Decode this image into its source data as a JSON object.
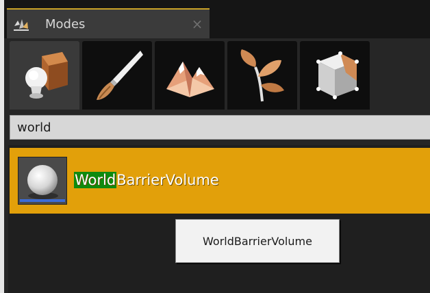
{
  "window": {
    "tab_title": "Modes",
    "tab_icon": "modes-icon",
    "close_glyph": "×"
  },
  "mode_buttons": [
    {
      "name": "place-mode",
      "icon": "place-actors-icon",
      "active": true
    },
    {
      "name": "paint-mode",
      "icon": "paintbrush-icon",
      "active": false
    },
    {
      "name": "landscape-mode",
      "icon": "mountains-icon",
      "active": false
    },
    {
      "name": "foliage-mode",
      "icon": "leaf-branch-icon",
      "active": false
    },
    {
      "name": "geometry-mode",
      "icon": "cube-edit-icon",
      "active": false
    }
  ],
  "search": {
    "value": "world",
    "placeholder": ""
  },
  "results": [
    {
      "match": "World",
      "rest": "BarrierVolume",
      "icon": "sphere-icon"
    }
  ],
  "tooltip": {
    "text": "WorldBarrierVolume"
  },
  "colors": {
    "accent": "#e2a00a",
    "highlight": "#0f8a0f",
    "thumb_bar": "#3c6cd6"
  }
}
